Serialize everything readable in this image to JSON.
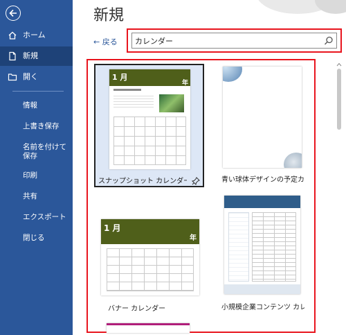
{
  "nav": {
    "items": [
      {
        "label": "ホーム"
      },
      {
        "label": "新規"
      },
      {
        "label": "開く"
      }
    ],
    "sub": [
      {
        "label": "情報"
      },
      {
        "label": "上書き保存"
      },
      {
        "label": "名前を付けて保存"
      },
      {
        "label": "印刷"
      },
      {
        "label": "共有"
      },
      {
        "label": "エクスポート"
      },
      {
        "label": "閉じる"
      }
    ]
  },
  "main": {
    "title": "新規",
    "back_label": "← 戻る",
    "search": {
      "value": "カレンダー"
    }
  },
  "templates": [
    {
      "label": "スナップショット カレンダー",
      "month": "1 月",
      "year": "年"
    },
    {
      "label": "青い球体デザインの予定カレ…"
    },
    {
      "label": "バナー カレンダー",
      "month": "1 月",
      "year": "年"
    },
    {
      "label": "小規模企業コンテンツ カレ…"
    }
  ],
  "colors": {
    "sidebar": "#2b579a",
    "highlight": "#e8141d"
  }
}
